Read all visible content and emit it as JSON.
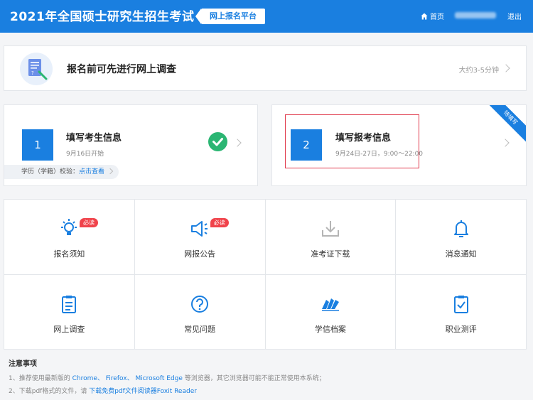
{
  "header": {
    "title": "2021年全国硕士研究生招生考试",
    "platform": "网上报名平台",
    "home": "首页",
    "logout": "退出",
    "color": "#1a7fe0"
  },
  "survey": {
    "title": "报名前可先进行网上调查",
    "duration": "大约3-5分钟",
    "icon": "survey-document-icon"
  },
  "step1": {
    "number": "1",
    "title": "填写考生信息",
    "date": "9月16日开始",
    "edu_label": "学历（学籍）校验：",
    "edu_link": "点击查看",
    "status": "completed"
  },
  "step2": {
    "number": "2",
    "title": "填写报考信息",
    "date": "9月24日-27日，9:00～22:00",
    "ribbon": "待填写"
  },
  "tiles": [
    {
      "label": "报名须知",
      "icon": "lightbulb-icon",
      "badge": "必读"
    },
    {
      "label": "网报公告",
      "icon": "megaphone-icon",
      "badge": "必读"
    },
    {
      "label": "准考证下载",
      "icon": "download-icon"
    },
    {
      "label": "消息通知",
      "icon": "bell-icon"
    },
    {
      "label": "网上调查",
      "icon": "clipboard-list-icon"
    },
    {
      "label": "常见问题",
      "icon": "question-icon"
    },
    {
      "label": "学信档案",
      "icon": "xuexin-logo-icon"
    },
    {
      "label": "职业测评",
      "icon": "clipboard-check-icon"
    }
  ],
  "notes": {
    "title": "注意事项",
    "line1": {
      "prefix": "1、推荐使用最新版的 ",
      "chrome": "Chrome、",
      "firefox": "Firefox、",
      "edge": "Microsoft Edge",
      "suffix": " 等浏览器，其它浏览器可能不能正常使用本系统；"
    },
    "line2": {
      "prefix": "2、下载pdf格式的文件，请 ",
      "link": "下载免费pdf文件阅读器Foxit Reader"
    }
  }
}
